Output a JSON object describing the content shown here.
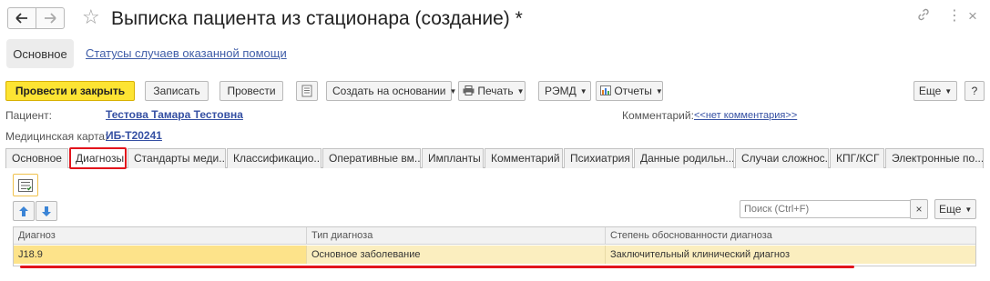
{
  "window": {
    "title": "Выписка пациента из стационара (создание) *",
    "back_icon": "arrow-left",
    "forward_icon": "arrow-right",
    "star_icon": "star",
    "link_icon": "link",
    "menu_icon": "more-vertical",
    "close_icon": "close"
  },
  "subnav": {
    "main": "Основное",
    "link": "Статусы случаев оказанной помощи"
  },
  "toolbar": {
    "post_close": "Провести и закрыть",
    "save": "Записать",
    "post": "Провести",
    "create_based": "Создать на основании",
    "print": "Печать",
    "remd": "РЭМД",
    "reports": "Отчеты",
    "more": "Еще",
    "help": "?"
  },
  "patient": {
    "label": "Пациент:",
    "name": "Тестова Тамара Тестовна",
    "card_label": "Медицинская карта:",
    "card_value": "ИБ-Т20241",
    "comment_label": "Комментарий:",
    "comment_value": "<<нет комментария>>"
  },
  "tabs": [
    {
      "label": "Основное"
    },
    {
      "label": "Диагнозы"
    },
    {
      "label": "Стандарты меди..."
    },
    {
      "label": "Классификацио..."
    },
    {
      "label": "Оперативные вм..."
    },
    {
      "label": "Импланты"
    },
    {
      "label": "Комментарий"
    },
    {
      "label": "Психиатрия"
    },
    {
      "label": "Данные родильн..."
    },
    {
      "label": "Случаи сложнос..."
    },
    {
      "label": "КПГ/КСГ"
    },
    {
      "label": "Электронные по..."
    }
  ],
  "diagnoses": {
    "search_placeholder": "Поиск (Ctrl+F)",
    "clear": "×",
    "more": "Еще",
    "columns": [
      "Диагноз",
      "Тип диагноза",
      "Степень обоснованности диагноза"
    ],
    "rows": [
      [
        "J18.9",
        "Основное заболевание",
        "Заключительный клинический диагноз"
      ]
    ]
  },
  "colors": {
    "primary_button": "#fde433",
    "highlight": "#e2141c",
    "link": "#3550a3",
    "selected_row": "#fbeebf"
  }
}
